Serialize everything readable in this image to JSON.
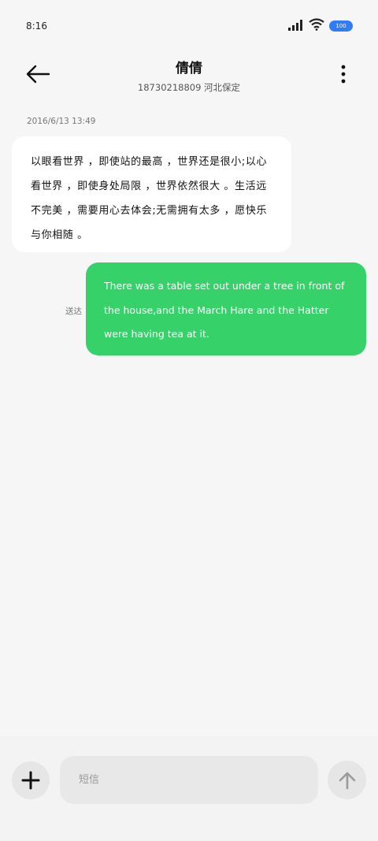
{
  "status_bar": {
    "time": "8:16",
    "battery": "100",
    "icons": [
      "signal-icon",
      "wifi-icon",
      "battery-icon"
    ]
  },
  "header": {
    "contact_name": "倩倩",
    "contact_subtitle": "18730218809  河北保定",
    "back_icon": "arrow-left-icon",
    "more_icon": "more-vertical-icon"
  },
  "conversation": {
    "timestamp": "2016/6/13  13:49",
    "messages": [
      {
        "direction": "incoming",
        "text": "以眼看世界 ，即使站的最高 ，世界还是很小;以心看世界 ，即使身处局限 ，世界依然很大 。生活远不完美 ，需要用心去体会;无需拥有太多 ，愿快乐与你相随 。"
      },
      {
        "direction": "outgoing",
        "text": "There was a table set out under a tree in front of the house,and the March Hare and the Hatter were having tea at it.",
        "status": "送达"
      }
    ]
  },
  "composer": {
    "placeholder": "短信",
    "value": "",
    "add_icon": "plus-icon",
    "send_icon": "arrow-up-icon"
  },
  "colors": {
    "background": "#f6f6f6",
    "outgoing_bubble": "#37d16a",
    "incoming_bubble": "#ffffff",
    "battery": "#2f7cf6"
  }
}
